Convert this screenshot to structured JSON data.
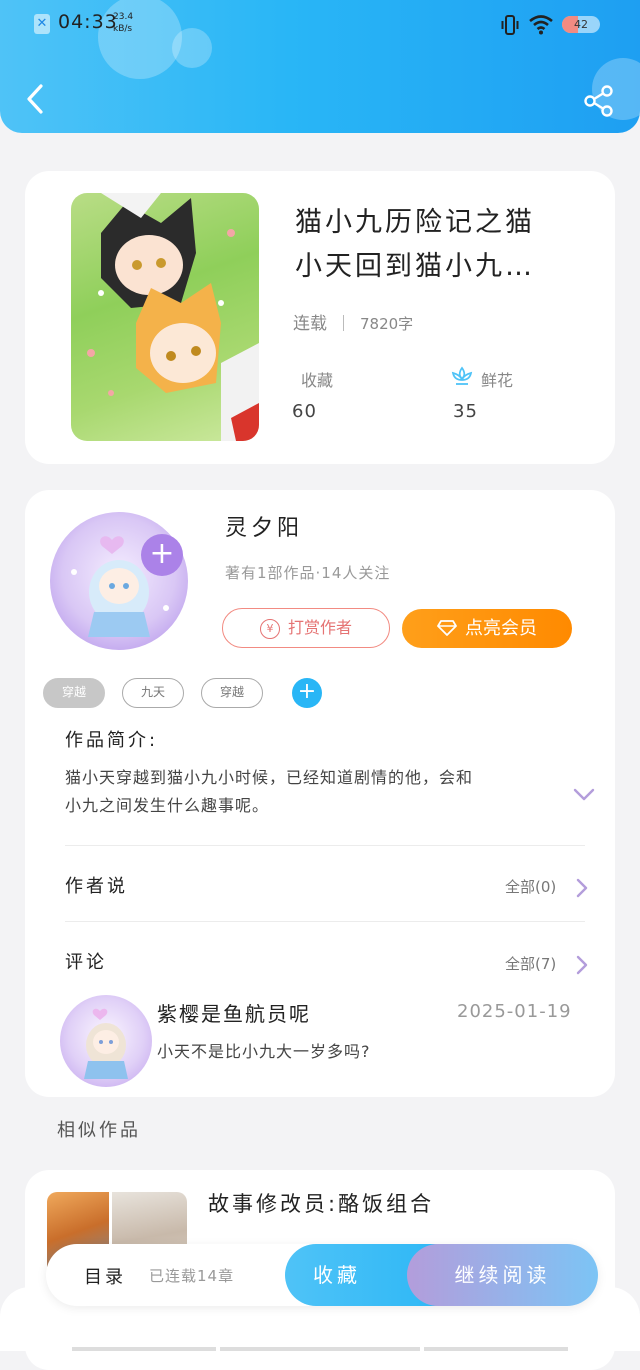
{
  "status_bar": {
    "time": "04:33",
    "net_speed_value": "23.4",
    "net_speed_unit": "kB/s",
    "battery_level": "42",
    "battery_fraction": 0.42
  },
  "header": {
    "back_icon": "chevron-left-icon",
    "share_icon": "share-icon"
  },
  "book": {
    "title_line1": "猫小九历险记之猫",
    "title_line2": "小天回到猫小九…",
    "status": "连载",
    "word_count": "7820字",
    "favorites_label": "收藏",
    "favorites_value": "60",
    "flowers_label": "鲜花",
    "flowers_value": "35"
  },
  "author": {
    "name": "灵夕阳",
    "stats": "著有1部作品·14人关注",
    "tip_label": "打赏作者",
    "tip_icon": "yen",
    "vip_label": "点亮会员",
    "tags": [
      "穿越",
      "九天",
      "穿越"
    ]
  },
  "synopsis": {
    "title": "作品简介:",
    "text_line1": "猫小天穿越到猫小九小时候，已经知道剧情的他，会和",
    "text_line2": "小九之间发生什么趣事呢。"
  },
  "author_says": {
    "title": "作者说",
    "all_label": "全部(0)"
  },
  "comments": {
    "title": "评论",
    "all_label": "全部(7)",
    "items": [
      {
        "user": "紫樱是鱼航员呢",
        "date": "2025-01-19",
        "text": "小天不是比小九大一岁多吗?"
      }
    ]
  },
  "similar": {
    "title": "相似作品",
    "items": [
      {
        "title": "故事修改员:酪饭组合"
      }
    ]
  },
  "bottom_bar": {
    "toc_label": "目录",
    "chapter_count": "已连载14章",
    "collect_label": "收藏",
    "read_label": "继续阅读"
  },
  "colors": {
    "header_blue": "#29b6f6",
    "accent_purple": "#ab82e8",
    "tip_red": "#e57373",
    "vip_orange": "#ff9800"
  }
}
